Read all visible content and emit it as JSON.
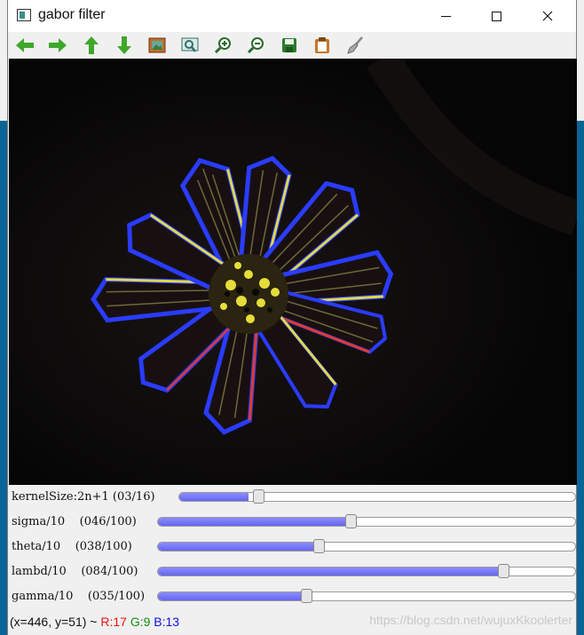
{
  "window": {
    "title": "gabor filter"
  },
  "toolbar": {
    "items": [
      {
        "icon": "arrow-left-icon",
        "color": "#3fa72b"
      },
      {
        "icon": "arrow-right-icon",
        "color": "#3fa72b"
      },
      {
        "icon": "arrow-up-icon",
        "color": "#3fa72b"
      },
      {
        "icon": "arrow-down-icon",
        "color": "#3fa72b"
      },
      {
        "icon": "image-icon"
      },
      {
        "icon": "zoom-region-icon"
      },
      {
        "icon": "zoom-in-icon"
      },
      {
        "icon": "zoom-out-icon"
      },
      {
        "icon": "save-icon"
      },
      {
        "icon": "copy-icon"
      },
      {
        "icon": "brush-icon"
      }
    ]
  },
  "sliders": [
    {
      "label": "kernelSize:2n+1 (03/16)",
      "value": 3,
      "max": 16
    },
    {
      "label": "sigma/10    (046/100)",
      "value": 46,
      "max": 100
    },
    {
      "label": "theta/10    (038/100)",
      "value": 38,
      "max": 100
    },
    {
      "label": "lambd/10    (084/100)",
      "value": 84,
      "max": 100
    },
    {
      "label": "gamma/10    (035/100)",
      "value": 35,
      "max": 100
    }
  ],
  "status": {
    "coords": "(x=446, y=51) ~ ",
    "r": "R:17",
    "g": "G:9",
    "b": "B:13",
    "watermark": "https://blog.csdn.net/wujuxKkoolerter"
  },
  "colors": {
    "slider_fill": "#7375f6",
    "canvas_bg": "#030303"
  }
}
